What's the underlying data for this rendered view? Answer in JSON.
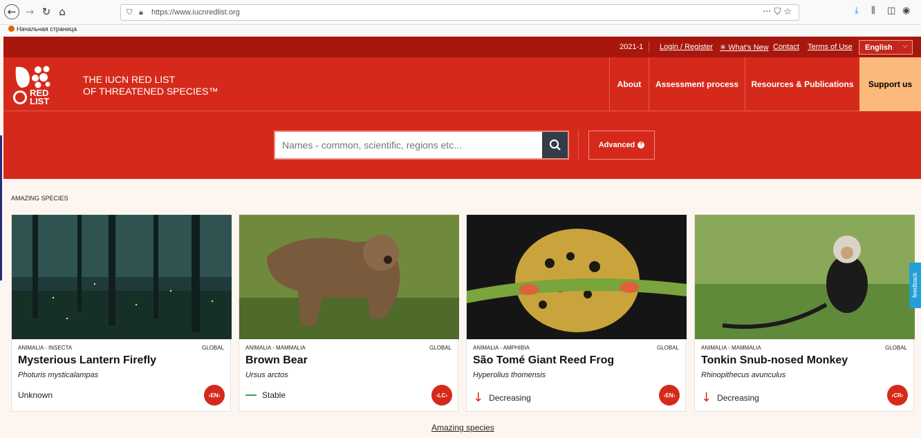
{
  "browser": {
    "url": "https://www.iucnredlist.org",
    "bookmark": "Начальная страница"
  },
  "topbar": {
    "year": "2021-1",
    "login": "Login / Register",
    "whats_new": "✳ What's New",
    "contact": "Contact",
    "terms": "Terms of Use",
    "language": "English"
  },
  "header": {
    "title_line1": "THE IUCN RED LIST",
    "title_line2": "OF THREATENED SPECIES™",
    "nav": [
      "About",
      "Assessment process",
      "Resources & Publications",
      "Support us"
    ]
  },
  "search": {
    "placeholder": "Names - common, scientific, regions etc...",
    "advanced": "Advanced"
  },
  "section": {
    "label": "AMAZING SPECIES",
    "link": "Amazing species"
  },
  "cards": [
    {
      "taxonomy": "ANIMALIA - INSECTA",
      "scope": "GLOBAL",
      "common": "Mysterious Lantern Firefly",
      "scientific": "Photuris mysticalampas",
      "trend": "Unknown",
      "status": "EN"
    },
    {
      "taxonomy": "ANIMALIA - MAMMALIA",
      "scope": "GLOBAL",
      "common": "Brown Bear",
      "scientific": "Ursus arctos",
      "trend": "Stable",
      "status": "LC"
    },
    {
      "taxonomy": "ANIMALIA - AMPHIBIA",
      "scope": "GLOBAL",
      "common": "São Tomé Giant Reed Frog",
      "scientific": "Hyperolius thomensis",
      "trend": "Decreasing",
      "status": "EN"
    },
    {
      "taxonomy": "ANIMALIA - MAMMALIA",
      "scope": "GLOBAL",
      "common": "Tonkin Snub-nosed Monkey",
      "scientific": "Rhinopithecus avunculus",
      "trend": "Decreasing",
      "status": "CR"
    }
  ],
  "feedback": "feedback",
  "colors": {
    "red": "#d52a1b",
    "dark_red": "#a8170d",
    "support": "#fbb97b",
    "feedback": "#1fa0d8"
  }
}
